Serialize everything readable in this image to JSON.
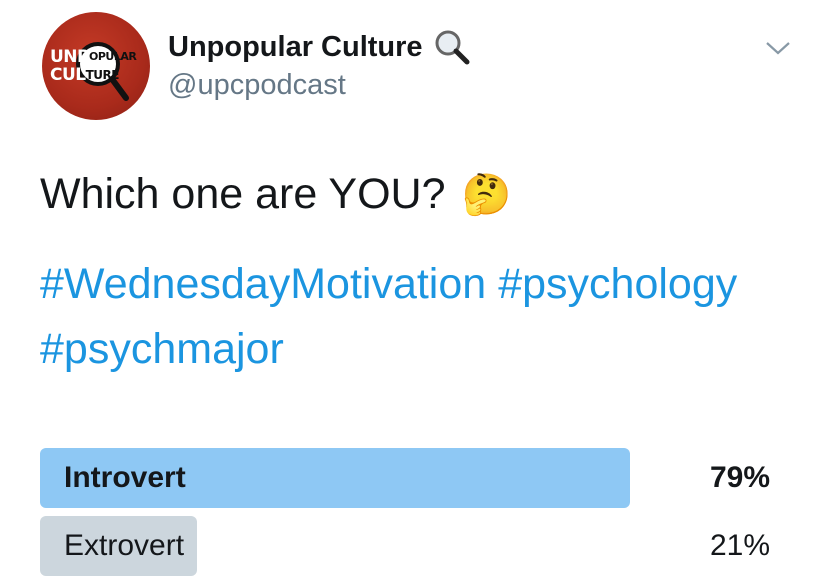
{
  "account": {
    "display_name": "Unpopular Culture",
    "handle": "@upcpodcast",
    "avatar_text_line1_a": "UNP",
    "avatar_text_line1_b": "OPULAR",
    "avatar_text_line2_a": "CUL",
    "avatar_text_line2_b": "TURE",
    "name_icon": "magnifying-glass-icon"
  },
  "tweet": {
    "text": "Which one are YOU?",
    "emoji": "🤔",
    "hashtags": [
      "#WednesdayMotivation",
      "#psychology",
      "#psychmajor"
    ]
  },
  "poll": {
    "options": [
      {
        "label": "Introvert",
        "percent": "79%",
        "value": 79,
        "winner": true
      },
      {
        "label": "Extrovert",
        "percent": "21%",
        "value": 21,
        "winner": false
      }
    ]
  },
  "colors": {
    "link": "#1b95e0",
    "winner_bar": "#8ec8f4",
    "loser_bar": "#ccd6dd",
    "avatar_bg": "#a92a1b"
  }
}
